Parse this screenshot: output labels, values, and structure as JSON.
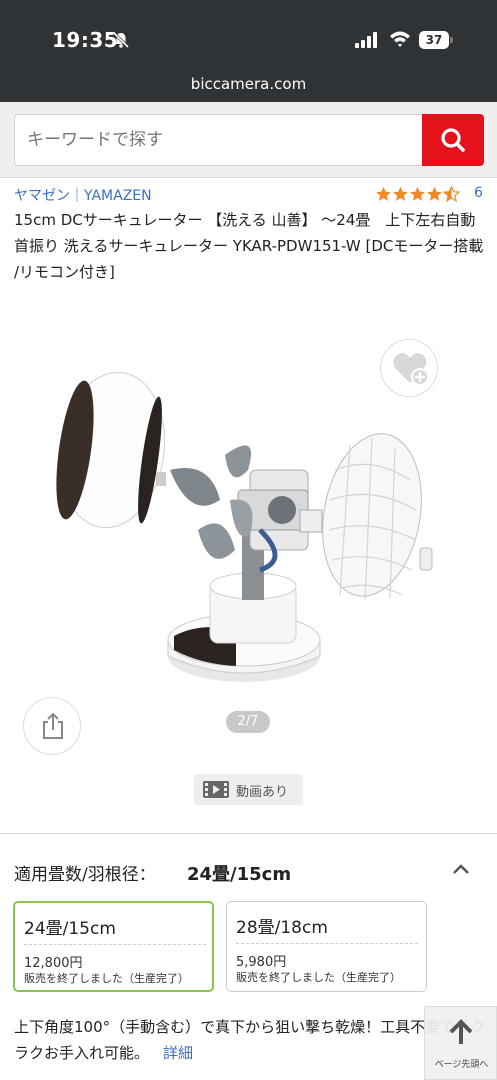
{
  "status_bar": {
    "time": "19:35",
    "battery": "37"
  },
  "browser": {
    "url": "biccamera.com"
  },
  "search": {
    "placeholder": "キーワードで探す",
    "button_icon": "search-icon",
    "button_color": "#e5121b"
  },
  "product": {
    "brand": "ヤマゼン｜YAMAZEN",
    "rating": 4.5,
    "review_count": "6",
    "title": "15cm DCサーキュレーター 【洗える 山善】 ～24畳　上下左右自動首振り 洗えるサーキュレーター YKAR-PDW151-W [DCモーター搭載 /リモコン付き]",
    "image_pager": "2/7",
    "video_badge": "動画あり"
  },
  "variation": {
    "label": "適用畳数/羽根径：",
    "selected_value": "24畳/15cm",
    "options": [
      {
        "size": "24畳/15cm",
        "price": "12,800円",
        "status": "販売を終了しました（生産完了）",
        "selected": true
      },
      {
        "size": "28畳/18cm",
        "price": "5,980円",
        "status": "販売を終了しました（生産完了）",
        "selected": false
      }
    ]
  },
  "description": {
    "text": "上下角度100°（手動含む）で真下から狙い撃ち乾燥！工具不要でラクラクお手入れ可能。",
    "more_link": "詳細"
  },
  "back_to_top": {
    "label": "ページ先頭へ"
  },
  "colors": {
    "accent_red": "#e5121b",
    "link_blue": "#3b6ec7",
    "star_orange": "#f08a24",
    "selected_green": "#8ac54b"
  }
}
